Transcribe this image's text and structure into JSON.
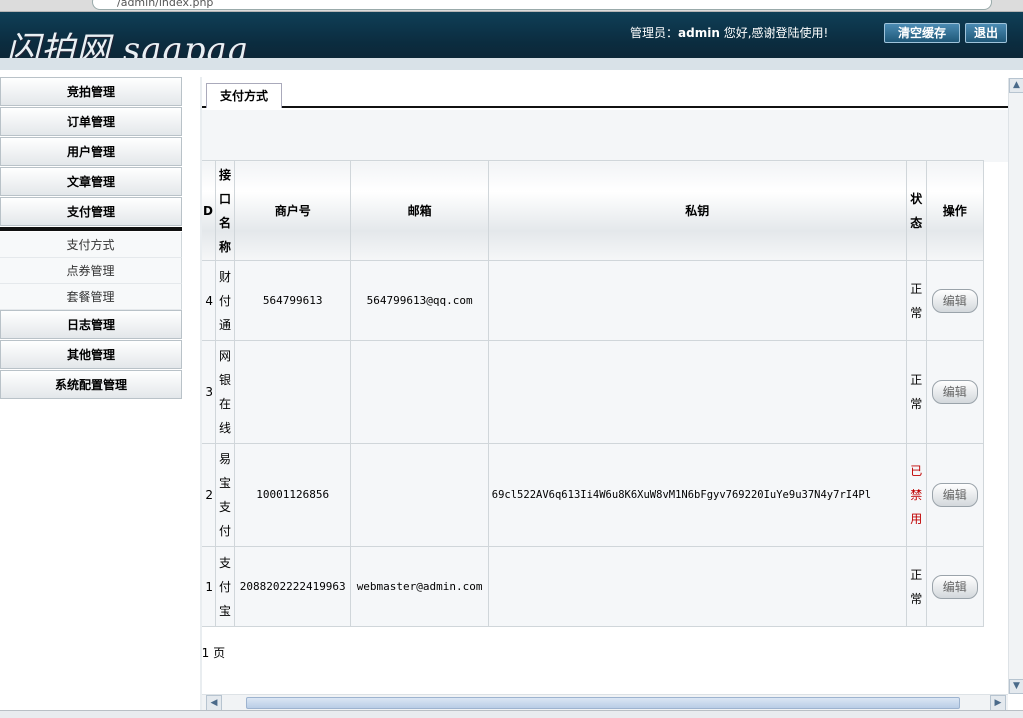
{
  "browser": {
    "url": "/admin/index.php"
  },
  "header": {
    "logo": "闪拍网 saapaa",
    "welcome_prefix": "管理员：",
    "username": "admin",
    "welcome_suffix": " 您好,感谢登陆使用!",
    "clear_cache_label": "清空缓存",
    "logout_label": "退出"
  },
  "sidebar": {
    "items": [
      {
        "label": "竞拍管理"
      },
      {
        "label": "订单管理"
      },
      {
        "label": "用户管理"
      },
      {
        "label": "文章管理"
      },
      {
        "label": "支付管理"
      },
      {
        "label": "日志管理"
      },
      {
        "label": "其他管理"
      },
      {
        "label": "系统配置管理"
      }
    ],
    "subitems": [
      {
        "label": "支付方式"
      },
      {
        "label": "点券管理"
      },
      {
        "label": "套餐管理"
      }
    ]
  },
  "main": {
    "tab_label": "支付方式",
    "columns": {
      "id": "ID",
      "name": "接口名称",
      "merchant": "商户号",
      "email": "邮箱",
      "key": "私钥",
      "status": "状态",
      "action": "操作"
    },
    "rows": [
      {
        "id": "4",
        "name": "财付通",
        "merchant": "564799613",
        "email": "564799613@qq.com",
        "key": "",
        "status": "正常",
        "action": "编辑"
      },
      {
        "id": "3",
        "name": "网银在线",
        "merchant": "",
        "email": "",
        "key": "",
        "status": "正常",
        "action": "编辑"
      },
      {
        "id": "2",
        "name": "易宝支付",
        "merchant": "10001126856",
        "email": "",
        "key": "69cl522AV6q613Ii4W6u8K6XuW8vM1N6bFgyv769220IuYe9u37N4y7rI4Pl",
        "status": "已禁用",
        "action": "编辑"
      },
      {
        "id": "1",
        "name": "支付宝",
        "merchant": "2088202222419963",
        "email": "webmaster@admin.com",
        "key": "",
        "status": "正常",
        "action": "编辑"
      }
    ],
    "pager": "1/1 页"
  },
  "colors": {
    "header_bg": "#0b2c3f",
    "disabled_status": "#c00000",
    "button_bg": "#1f5878"
  }
}
